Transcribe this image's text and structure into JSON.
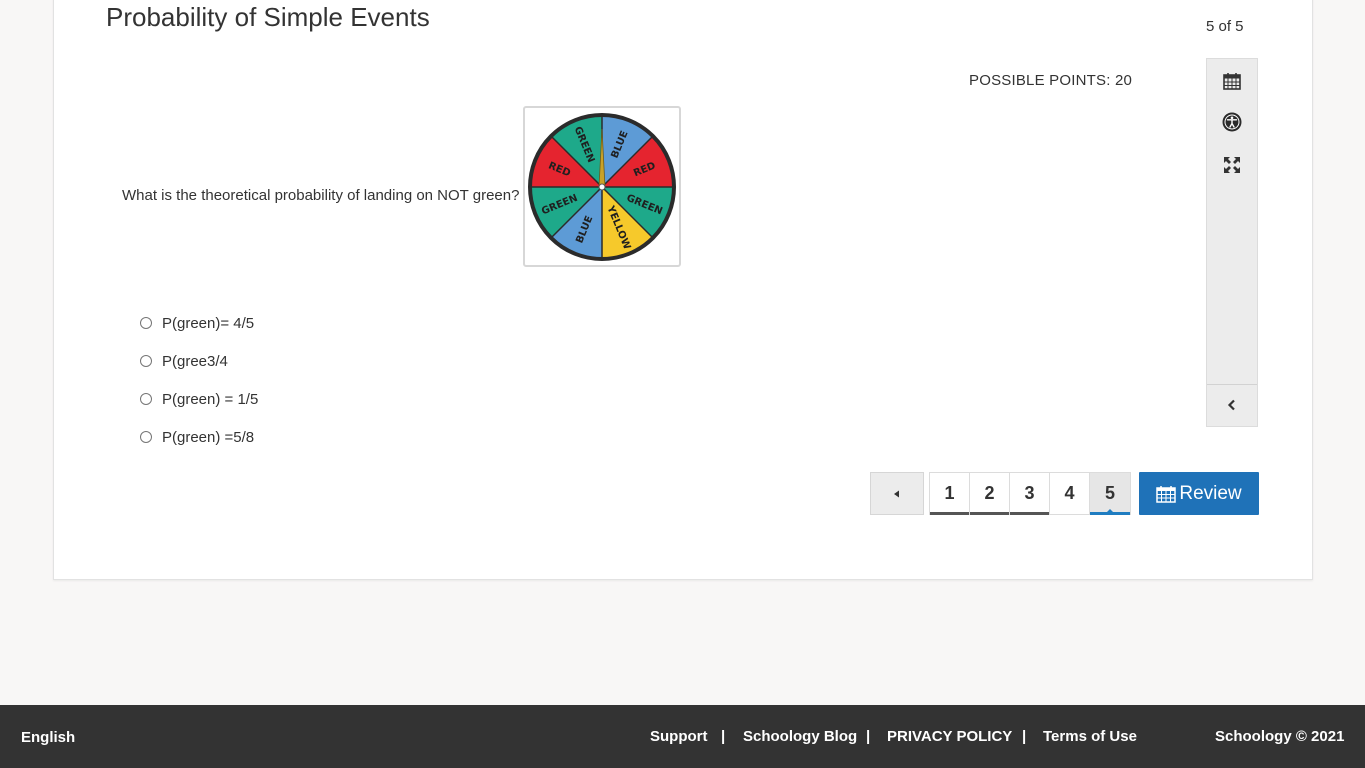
{
  "page": {
    "title": "Probability of Simple Events",
    "counter": "5 of 5",
    "points": "POSSIBLE POINTS: 20"
  },
  "question": {
    "text": "What is the theoretical probability of landing on NOT green?",
    "spinner": {
      "labels": [
        "GREEN",
        "BLUE",
        "RED",
        "GREEN",
        "YELLOW",
        "BLUE",
        "GREEN",
        "RED"
      ],
      "colors": {
        "green": "#1ea98a",
        "blue": "#5d9bd6",
        "red": "#e5242f",
        "yellow": "#f6c92b"
      }
    },
    "choices": [
      {
        "label": "P(green)= 4/5"
      },
      {
        "label": "P(gree3/4"
      },
      {
        "label": "P(green) = 1/5"
      },
      {
        "label": "P(green) =5/8"
      }
    ]
  },
  "toolbar": {
    "icons": [
      "calendar-icon",
      "accessibility-icon",
      "fullscreen-icon",
      "chevron-left-icon"
    ]
  },
  "pager": {
    "pages": [
      "1",
      "2",
      "3",
      "4",
      "5"
    ],
    "current": "5",
    "review_label": "Review"
  },
  "footer": {
    "language": "English",
    "links": [
      "Support",
      "Schoology Blog",
      "PRIVACY POLICY",
      "Terms of Use"
    ],
    "separator": "|",
    "copyright": "Schoology © 2021"
  }
}
